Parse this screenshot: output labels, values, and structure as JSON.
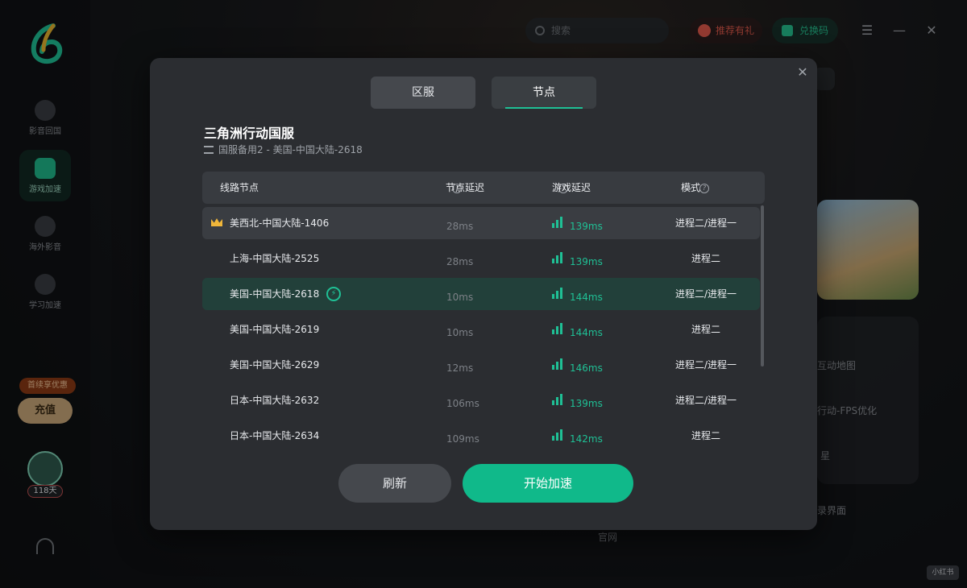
{
  "sidebar": {
    "items": [
      {
        "label": "影音回国"
      },
      {
        "label": "游戏加速"
      },
      {
        "label": "海外影音"
      },
      {
        "label": "学习加速"
      }
    ],
    "promo_badge": "首续享优惠",
    "recharge_label": "充值",
    "days_label": "118天"
  },
  "header": {
    "search_placeholder": "搜索",
    "recommend_label": "推荐有礼",
    "redeem_label": "兑换码"
  },
  "background": {
    "texts": [
      "互动地图",
      "行动-FPS优化",
      "星",
      "录界面",
      "官网"
    ]
  },
  "modal": {
    "tabs": [
      {
        "label": "区服",
        "active": false
      },
      {
        "label": "节点",
        "active": true
      }
    ],
    "game_title": "三角洲行动国服",
    "selection": "国服备用2 - 美国-中国大陆-2618",
    "columns": {
      "node": "线路节点",
      "node_latency": "节点延迟",
      "game_latency": "游戏延迟",
      "mode": "模式"
    },
    "rows": [
      {
        "name": "美西北-中国大陆-1406",
        "ping": "28ms",
        "game_ping": "139ms",
        "mode": "进程二/进程一",
        "crown": true,
        "state": "hover"
      },
      {
        "name": "上海-中国大陆-2525",
        "ping": "28ms",
        "game_ping": "139ms",
        "mode": "进程二"
      },
      {
        "name": "美国-中国大陆-2618",
        "ping": "10ms",
        "game_ping": "144ms",
        "mode": "进程二/进程一",
        "state": "selected"
      },
      {
        "name": "美国-中国大陆-2619",
        "ping": "10ms",
        "game_ping": "144ms",
        "mode": "进程二"
      },
      {
        "name": "美国-中国大陆-2629",
        "ping": "12ms",
        "game_ping": "146ms",
        "mode": "进程二/进程一"
      },
      {
        "name": "日本-中国大陆-2632",
        "ping": "106ms",
        "game_ping": "139ms",
        "mode": "进程二/进程一"
      },
      {
        "name": "日本-中国大陆-2634",
        "ping": "109ms",
        "game_ping": "142ms",
        "mode": "进程二"
      }
    ],
    "refresh_label": "刷新",
    "start_label": "开始加速"
  },
  "watermark": "小红书",
  "colors": {
    "accent": "#10b98a",
    "crown": "#f0b63a",
    "modal_bg": "#2b2d31"
  }
}
